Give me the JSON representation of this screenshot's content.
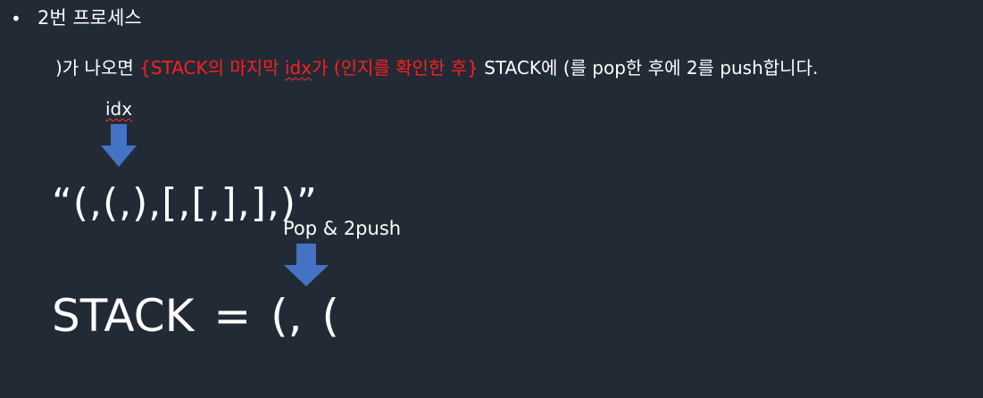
{
  "bullet": {
    "marker": "•",
    "title": "2번 프로세스"
  },
  "description": {
    "part1": ")가 나오면 ",
    "red_part1": "{STACK의 마지막 ",
    "red_idx": "idx",
    "red_part2": "가 (인지를 확인한 후}",
    "part2": " STACK에 (를 pop한 후에 2를 push합니다."
  },
  "idx_label": "idx",
  "sequence": "“(,(,),[,[,],],)”",
  "pop_label": "Pop & 2push",
  "stack": "STACK = (, (",
  "colors": {
    "background": "#222a35",
    "text": "#ffffff",
    "highlight": "#ff1f1f",
    "arrow": "#4472c4"
  }
}
